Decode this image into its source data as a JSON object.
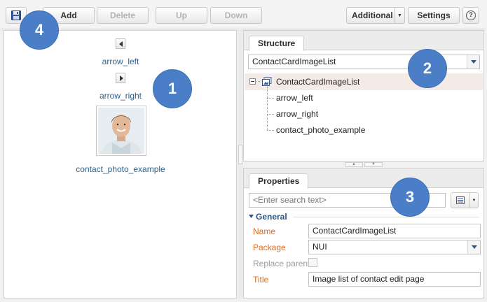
{
  "toolbar": {
    "add_label": "Add",
    "delete_label": "Delete",
    "up_label": "Up",
    "down_label": "Down",
    "additional_label": "Additional",
    "settings_label": "Settings"
  },
  "left_panel": {
    "items": [
      {
        "label": "arrow_left"
      },
      {
        "label": "arrow_right"
      },
      {
        "label": "contact_photo_example"
      }
    ]
  },
  "structure": {
    "tab_label": "Structure",
    "selected_value": "ContactCardImageList",
    "tree": {
      "root": "ContactCardImageList",
      "children": [
        "arrow_left",
        "arrow_right",
        "contact_photo_example"
      ]
    }
  },
  "properties": {
    "tab_label": "Properties",
    "search_placeholder": "<Enter search text>",
    "group_label": "General",
    "fields": {
      "name_label": "Name",
      "name_value": "ContactCardImageList",
      "package_label": "Package",
      "package_value": "NUI",
      "replace_parent_label": "Replace parent",
      "title_label": "Title",
      "title_value": "Image list of contact edit page"
    }
  },
  "callouts": [
    "1",
    "2",
    "3",
    "4"
  ],
  "colors": {
    "callout": "#4a7fc8",
    "link_text": "#2f5f8a",
    "required_label": "#e06b1f",
    "tree_selected": "#f4ebe6"
  }
}
